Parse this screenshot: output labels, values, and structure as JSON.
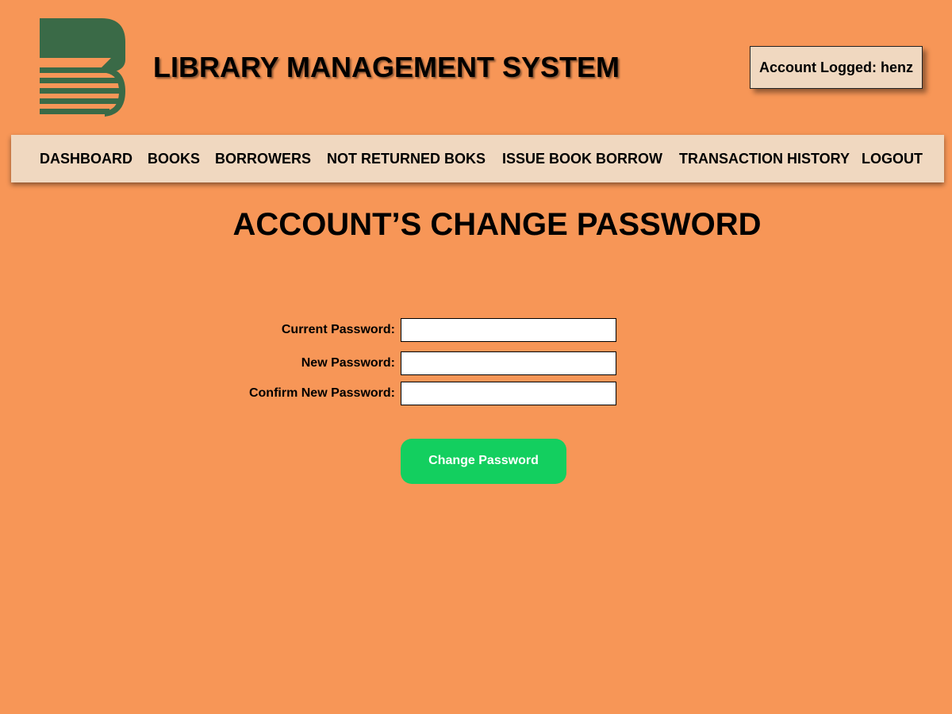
{
  "header": {
    "logo_icon": "library-book-logo-icon",
    "title": "LIBRARY MANAGEMENT SYSTEM",
    "account_label": "Account Logged: henz"
  },
  "nav": {
    "items": [
      {
        "label": "DASHBOARD"
      },
      {
        "label": "BOOKS"
      },
      {
        "label": "BORROWERS"
      },
      {
        "label": "NOT RETURNED BOKS"
      },
      {
        "label": "ISSUE BOOK BORROW"
      },
      {
        "label": "TRANSACTION HISTORY"
      },
      {
        "label": "LOGOUT"
      }
    ]
  },
  "page": {
    "title": "ACCOUNT’S CHANGE PASSWORD"
  },
  "form": {
    "current_password_label": "Current Password:",
    "current_password_value": "",
    "new_password_label": "New Password:",
    "new_password_value": "",
    "confirm_password_label": "Confirm New Password:",
    "confirm_password_value": "",
    "submit_label": "Change Password"
  },
  "colors": {
    "background": "#F79657",
    "nav_background": "#F0D8C0",
    "logo_green": "#3A6A47",
    "button_green": "#13CF5F"
  }
}
